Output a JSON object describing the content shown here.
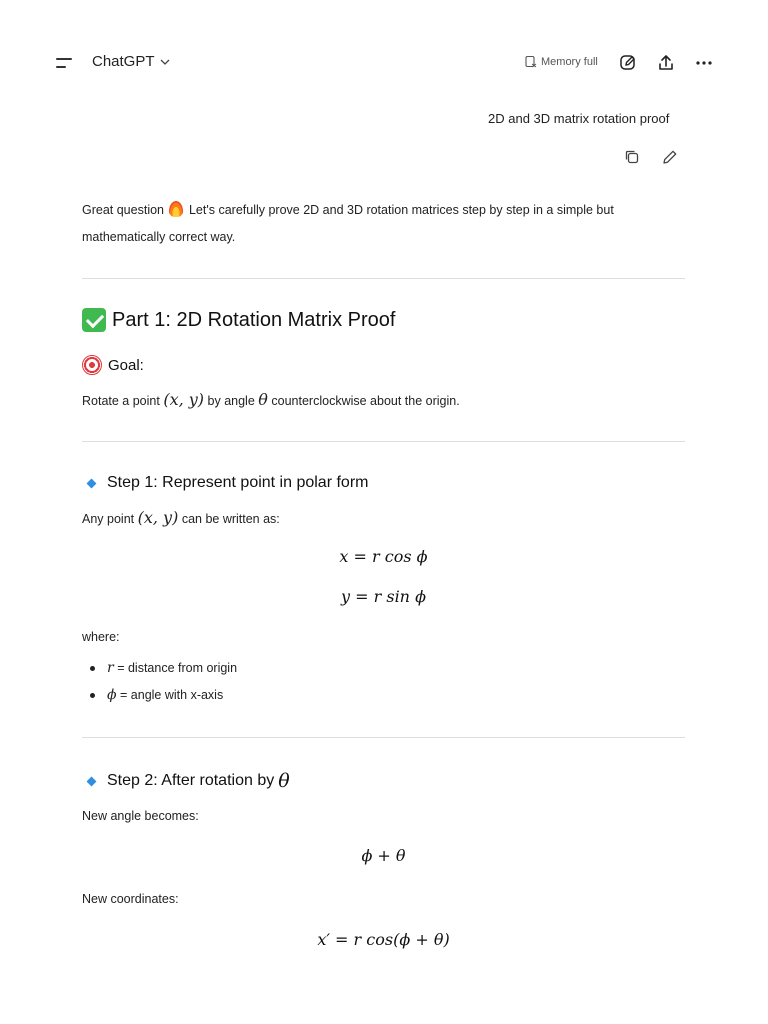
{
  "header": {
    "app_title": "ChatGPT",
    "memory_label": "Memory full"
  },
  "user_message": "2D and 3D matrix rotation proof",
  "intro": {
    "line1_a": "Great question",
    "line1_b": "Let's carefully prove 2D and 3D rotation matrices step by step in a simple but",
    "line2": "mathematically correct way."
  },
  "part1": {
    "title": "Part 1: 2D Rotation Matrix Proof",
    "goal_label": "Goal:",
    "goal_text_a": "Rotate a point",
    "goal_math_point": "(x, y)",
    "goal_text_b": "by angle",
    "goal_math_theta": "θ",
    "goal_text_c": "counterclockwise about the origin."
  },
  "step1": {
    "title": "Step 1: Represent point in polar form",
    "text_a": "Any point",
    "math_point": "(x, y)",
    "text_b": "can be written as:",
    "eq1": "x = r cos ϕ",
    "eq2": "y = r sin ϕ",
    "where": "where:",
    "bullets": [
      {
        "sym": "r",
        "text": "= distance from origin"
      },
      {
        "sym": "ϕ",
        "text": "= angle with x-axis"
      }
    ]
  },
  "step2": {
    "title": "Step 2: After rotation by",
    "title_math": "θ",
    "new_angle_label": "New angle becomes:",
    "eq_angle": "ϕ + θ",
    "new_coords_label": "New coordinates:",
    "eq_x": "x′ = r cos(ϕ + θ)"
  },
  "icons": [
    "menu-icon",
    "chevron-down-icon",
    "memory-icon",
    "edit-chat-icon",
    "share-icon",
    "more-icon",
    "copy-icon",
    "pencil-icon",
    "fire-emoji-icon",
    "check-emoji-icon",
    "target-emoji-icon",
    "diamond-bullet-icon"
  ]
}
